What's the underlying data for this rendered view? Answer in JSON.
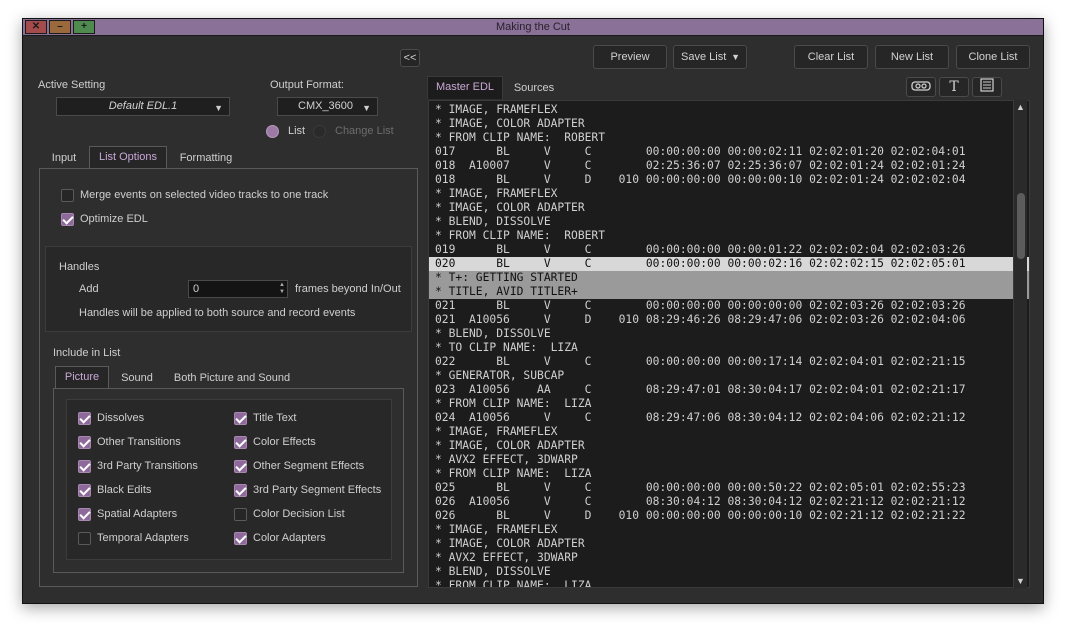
{
  "window": {
    "title": "Making the Cut"
  },
  "toolbar": {
    "collapse_label": "<<",
    "preview": "Preview",
    "save_list": "Save List",
    "clear_list": "Clear List",
    "new_list": "New List",
    "clone_list": "Clone List"
  },
  "settings": {
    "active_setting_label": "Active Setting",
    "active_setting_value": "Default EDL.1",
    "output_format_label": "Output Format:",
    "output_format_value": "CMX_3600",
    "radio_list": "List",
    "radio_change_list": "Change List"
  },
  "tabs": {
    "input": "Input",
    "list_options": "List Options",
    "formatting": "Formatting"
  },
  "options": {
    "merge": "Merge events on selected video tracks to one track",
    "optimize": "Optimize EDL"
  },
  "handles": {
    "title": "Handles",
    "add_label": "Add",
    "add_value": "0",
    "suffix": "frames beyond In/Out",
    "note": "Handles will be applied to both source and record events"
  },
  "include": {
    "title": "Include in List",
    "tabs": [
      "Picture",
      "Sound",
      "Both Picture and Sound"
    ],
    "left": [
      {
        "label": "Dissolves",
        "checked": true
      },
      {
        "label": "Other Transitions",
        "checked": true
      },
      {
        "label": "3rd Party Transitions",
        "checked": true
      },
      {
        "label": "Black Edits",
        "checked": true
      },
      {
        "label": "Spatial Adapters",
        "checked": true
      },
      {
        "label": "Temporal Adapters",
        "checked": false
      }
    ],
    "right": [
      {
        "label": "Title Text",
        "checked": true
      },
      {
        "label": "Color Effects",
        "checked": true
      },
      {
        "label": "Other Segment Effects",
        "checked": true
      },
      {
        "label": "3rd Party Segment Effects",
        "checked": true
      },
      {
        "label": "Color Decision List",
        "checked": false
      },
      {
        "label": "Color Adapters",
        "checked": true
      }
    ]
  },
  "edl_tabs": {
    "master": "Master EDL",
    "sources": "Sources"
  },
  "edl_icons": [
    "tape-icon",
    "text-icon",
    "list-icon"
  ],
  "edl_lines": [
    {
      "text": "* IMAGE, FRAMEFLEX",
      "hl": ""
    },
    {
      "text": "* IMAGE, COLOR ADAPTER",
      "hl": ""
    },
    {
      "text": "* FROM CLIP NAME:  ROBERT",
      "hl": ""
    },
    {
      "text": "017      BL     V     C        00:00:00:00 00:00:02:11 02:02:01:20 02:02:04:01",
      "hl": ""
    },
    {
      "text": "018  A10007     V     C        02:25:36:07 02:25:36:07 02:02:01:24 02:02:01:24",
      "hl": ""
    },
    {
      "text": "018      BL     V     D    010 00:00:00:00 00:00:00:10 02:02:01:24 02:02:02:04",
      "hl": ""
    },
    {
      "text": "* IMAGE, FRAMEFLEX",
      "hl": ""
    },
    {
      "text": "* IMAGE, COLOR ADAPTER",
      "hl": ""
    },
    {
      "text": "* BLEND, DISSOLVE",
      "hl": ""
    },
    {
      "text": "* FROM CLIP NAME:  ROBERT",
      "hl": ""
    },
    {
      "text": "019      BL     V     C        00:00:00:00 00:00:01:22 02:02:02:04 02:02:03:26",
      "hl": ""
    },
    {
      "text": "020      BL     V     C        00:00:00:00 00:00:02:16 02:02:02:15 02:02:05:01",
      "hl": "sel"
    },
    {
      "text": "* T+: GETTING STARTED",
      "hl": "sel"
    },
    {
      "text": "* TITLE, AVID TITLER+",
      "hl": "sel"
    },
    {
      "text": "021      BL     V     C        00:00:00:00 00:00:00:00 02:02:03:26 02:02:03:26",
      "hl": ""
    },
    {
      "text": "021  A10056     V     D    010 08:29:46:26 08:29:47:06 02:02:03:26 02:02:04:06",
      "hl": ""
    },
    {
      "text": "* BLEND, DISSOLVE",
      "hl": ""
    },
    {
      "text": "* TO CLIP NAME:  LIZA",
      "hl": ""
    },
    {
      "text": "022      BL     V     C        00:00:00:00 00:00:17:14 02:02:04:01 02:02:21:15",
      "hl": ""
    },
    {
      "text": "* GENERATOR, SUBCAP",
      "hl": ""
    },
    {
      "text": "023  A10056    AA     C        08:29:47:01 08:30:04:17 02:02:04:01 02:02:21:17",
      "hl": ""
    },
    {
      "text": "* FROM CLIP NAME:  LIZA",
      "hl": ""
    },
    {
      "text": "024  A10056     V     C        08:29:47:06 08:30:04:12 02:02:04:06 02:02:21:12",
      "hl": ""
    },
    {
      "text": "* IMAGE, FRAMEFLEX",
      "hl": ""
    },
    {
      "text": "* IMAGE, COLOR ADAPTER",
      "hl": ""
    },
    {
      "text": "* AVX2 EFFECT, 3DWARP",
      "hl": ""
    },
    {
      "text": "* FROM CLIP NAME:  LIZA",
      "hl": ""
    },
    {
      "text": "025      BL     V     C        00:00:00:00 00:00:50:22 02:02:05:01 02:02:55:23",
      "hl": ""
    },
    {
      "text": "026  A10056     V     C        08:30:04:12 08:30:04:12 02:02:21:12 02:02:21:12",
      "hl": ""
    },
    {
      "text": "026      BL     V     D    010 00:00:00:00 00:00:00:10 02:02:21:12 02:02:21:22",
      "hl": ""
    },
    {
      "text": "* IMAGE, FRAMEFLEX",
      "hl": ""
    },
    {
      "text": "* IMAGE, COLOR ADAPTER",
      "hl": ""
    },
    {
      "text": "* AVX2 EFFECT, 3DWARP",
      "hl": ""
    },
    {
      "text": "* BLEND, DISSOLVE",
      "hl": ""
    },
    {
      "text": "* FROM CLIP NAME:  LIZA",
      "hl": ""
    }
  ],
  "colors": {
    "accent": "#9d7aa6",
    "titlebar": "#8a7197",
    "panel": "#2e2e2e"
  }
}
